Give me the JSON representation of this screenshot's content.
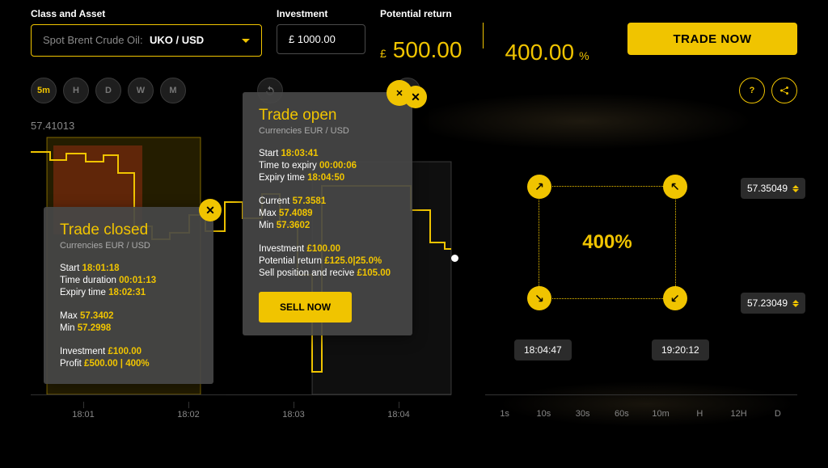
{
  "header": {
    "class_asset_label": "Class and Asset",
    "asset_name": "Spot Brent Crude Oil:",
    "asset_ticker": "UKO / USD",
    "investment_label": "Investment",
    "investment_value": "£ 1000.00",
    "potential_return_label": "Potential return",
    "return_currency": "£",
    "return_amount": "500.00",
    "return_pct": "400.00",
    "return_pct_sym": "%",
    "trade_now": "TRADE NOW"
  },
  "timeframes": {
    "b1": "5m",
    "b2": "H",
    "b3": "D",
    "b4": "W",
    "b5": "M"
  },
  "top_price": "57.41013",
  "chart_data": {
    "type": "line",
    "x": [
      "18:01",
      "18:02",
      "18:03",
      "18:04"
    ],
    "candles_zone": {
      "start": "18:01",
      "end": "18:01:40",
      "low": 57.3,
      "high": 57.42,
      "color": "red"
    },
    "yellow_zone": {
      "start": "18:01:18",
      "end": "18:02:31"
    },
    "grey_zone": {
      "start": "18:03:41",
      "end": "18:04:50"
    },
    "price_line": [
      57.42,
      57.4,
      57.41,
      57.4,
      57.41,
      57.38,
      57.32,
      57.3,
      57.31,
      57.33,
      57.31,
      57.36,
      57.34,
      57.37,
      57.33,
      57.3,
      57.4,
      57.4,
      57.38,
      57.36,
      57.36,
      57.36
    ],
    "ylim": [
      57.25,
      57.45
    ],
    "xlabel": "",
    "ylabel": ""
  },
  "xticks": {
    "t1": "18:01",
    "t2": "18:02",
    "t3": "18:03",
    "t4": "18:04"
  },
  "right": {
    "pct": "400%",
    "price_upper": "57.35049",
    "price_lower": "57.23049",
    "time_left": "18:04:47",
    "time_right": "19:20:12",
    "options": {
      "e1": "1s",
      "e2": "10s",
      "e3": "30s",
      "e4": "60s",
      "e5": "10m",
      "e6": "H",
      "e7": "12H",
      "e8": "D"
    }
  },
  "closed": {
    "title": "Trade closed",
    "sub": "Currencies EUR / USD",
    "start_l": "Start",
    "start_v": "18:01:18",
    "dur_l": "Time duration",
    "dur_v": "00:01:13",
    "exp_l": "Expiry time",
    "exp_v": "18:02:31",
    "max_l": "Max",
    "max_v": "57.3402",
    "min_l": "Min",
    "min_v": "57.2998",
    "inv_l": "Investment",
    "inv_v": "£100.00",
    "profit_l": "Profit",
    "profit_v": "£500.00 | 400%"
  },
  "open": {
    "title": "Trade open",
    "sub": "Currencies EUR / USD",
    "start_l": "Start",
    "start_v": "18:03:41",
    "tte_l": "Time to expiry",
    "tte_v": "00:00:06",
    "exp_l": "Expiry time",
    "exp_v": "18:04:50",
    "cur_l": "Current",
    "cur_v": "57.3581",
    "max_l": "Max",
    "max_v": "57.4089",
    "min_l": "Min",
    "min_v": "57.3602",
    "inv_l": "Investment",
    "inv_v": "£100.00",
    "pr_l": "Potential return",
    "pr_v": "£125.0|25.0%",
    "sp_l": "Sell position and recive",
    "sp_v": "£105.00",
    "sell": "SELL NOW"
  }
}
